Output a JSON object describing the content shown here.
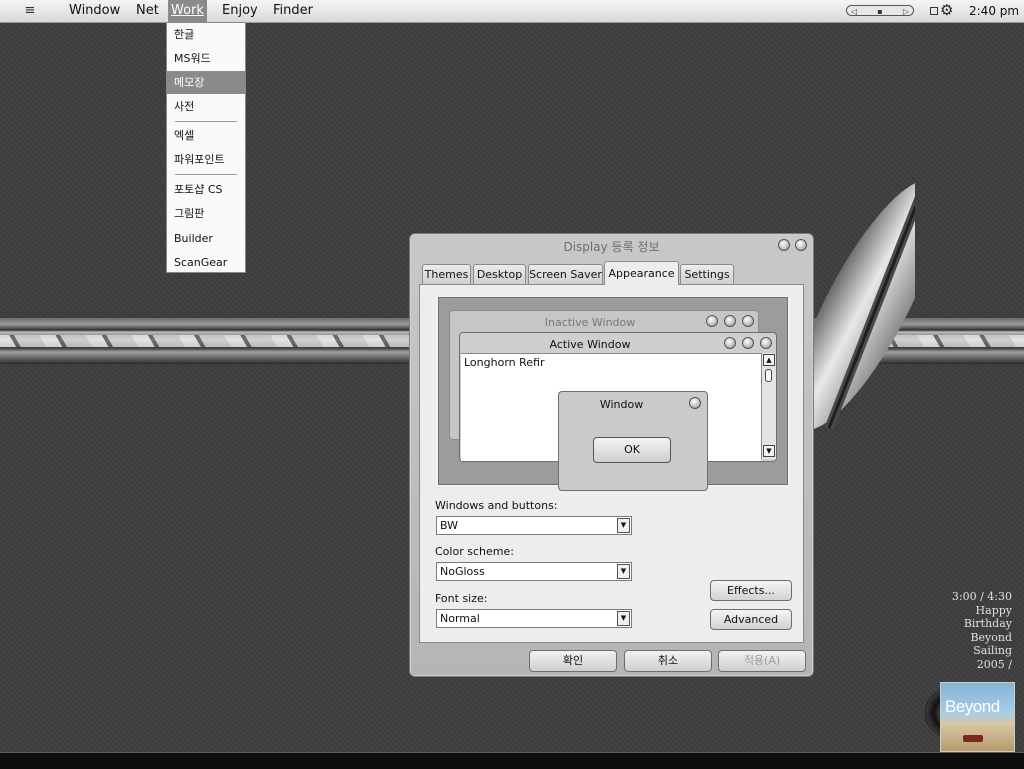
{
  "menubar": {
    "items": [
      "Window",
      "Net",
      "Work",
      "Enjoy",
      "Finder"
    ],
    "active_item": "Work",
    "clock": "2:40 pm",
    "player_controls": [
      "◁",
      "▪",
      "▷"
    ]
  },
  "work_menu": {
    "items": [
      "한글",
      "MS워드",
      "메모장",
      "사전",
      "엑셀",
      "파워포인트",
      "포토샵 CS",
      "그림판",
      "Builder",
      "ScanGear"
    ],
    "selected": "메모장"
  },
  "dialog": {
    "title": "Display 등록 정보",
    "tabs": [
      "Themes",
      "Desktop",
      "Screen Saver",
      "Appearance",
      "Settings"
    ],
    "active_tab": "Appearance",
    "preview": {
      "inactive_title": "Inactive Window",
      "active_title": "Active Window",
      "body_text": "Longhorn Refir",
      "msgbox_title": "Window",
      "ok_label": "OK"
    },
    "fields": {
      "windows_buttons_label": "Windows and buttons:",
      "windows_buttons_value": "BW",
      "color_scheme_label": "Color scheme:",
      "color_scheme_value": "NoGloss",
      "font_size_label": "Font size:",
      "font_size_value": "Normal"
    },
    "buttons": {
      "effects": "Effects...",
      "advanced": "Advanced",
      "ok": "확인",
      "cancel": "취소",
      "apply": "적용(A)"
    }
  },
  "now_playing": {
    "time": "3:00 / 4:30",
    "lines": [
      "Happy",
      "Birthday",
      "Beyond",
      "Sailing",
      "2005 /"
    ],
    "album_title": "Beyond"
  },
  "icons": {
    "menu_logo": "menu-logo-icon",
    "gear": "gear-icon",
    "scroll_up": "scroll-up-arrow-icon",
    "scroll_down": "scroll-down-arrow-icon",
    "dropdown_arrow": "chevron-down-icon"
  },
  "colors": {
    "desktop": "#3e3e3e",
    "menu_highlight": "#8a8a8a",
    "dialog_bg": "#bdbdbd"
  }
}
